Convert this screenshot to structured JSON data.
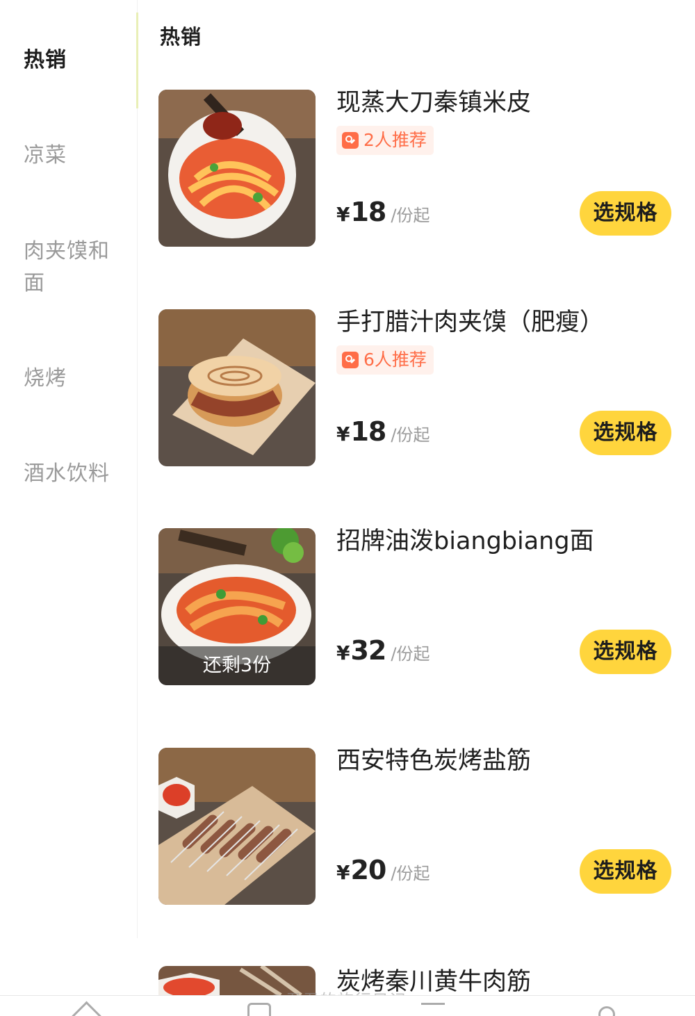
{
  "sidebar": {
    "categories": [
      {
        "label": "热销",
        "active": true
      },
      {
        "label": "凉菜",
        "active": false
      },
      {
        "label": "肉夹馍和面",
        "active": false
      },
      {
        "label": "烧烤",
        "active": false
      },
      {
        "label": "酒水饮料",
        "active": false
      }
    ]
  },
  "main": {
    "section_title": "热销",
    "items": [
      {
        "name": "现蒸大刀秦镇米皮",
        "recommend": "2人推荐",
        "price": "18",
        "unit": "/份起",
        "action": "选规格"
      },
      {
        "name": "手打腊汁肉夹馍（肥瘦）",
        "recommend": "6人推荐",
        "price": "18",
        "unit": "/份起",
        "action": "选规格"
      },
      {
        "name": "招牌油泼biangbiang面",
        "stock": "还剩3份",
        "price": "32",
        "unit": "/份起",
        "action": "选规格"
      },
      {
        "name": "西安特色炭烤盐筋",
        "price": "20",
        "unit": "/份起",
        "action": "选规格"
      },
      {
        "name": "炭烤秦川黄牛肉筋"
      }
    ],
    "currency_symbol": "¥"
  },
  "watermark": "@君君的旅行日记",
  "colors": {
    "accent_yellow": "#ffd53d",
    "recommend_orange": "#ff6d47",
    "muted_text": "#9a9a9a"
  },
  "icons": [
    "food-photo",
    "recommend-icon",
    "home-icon",
    "bag-icon",
    "cart-icon",
    "user-icon"
  ]
}
